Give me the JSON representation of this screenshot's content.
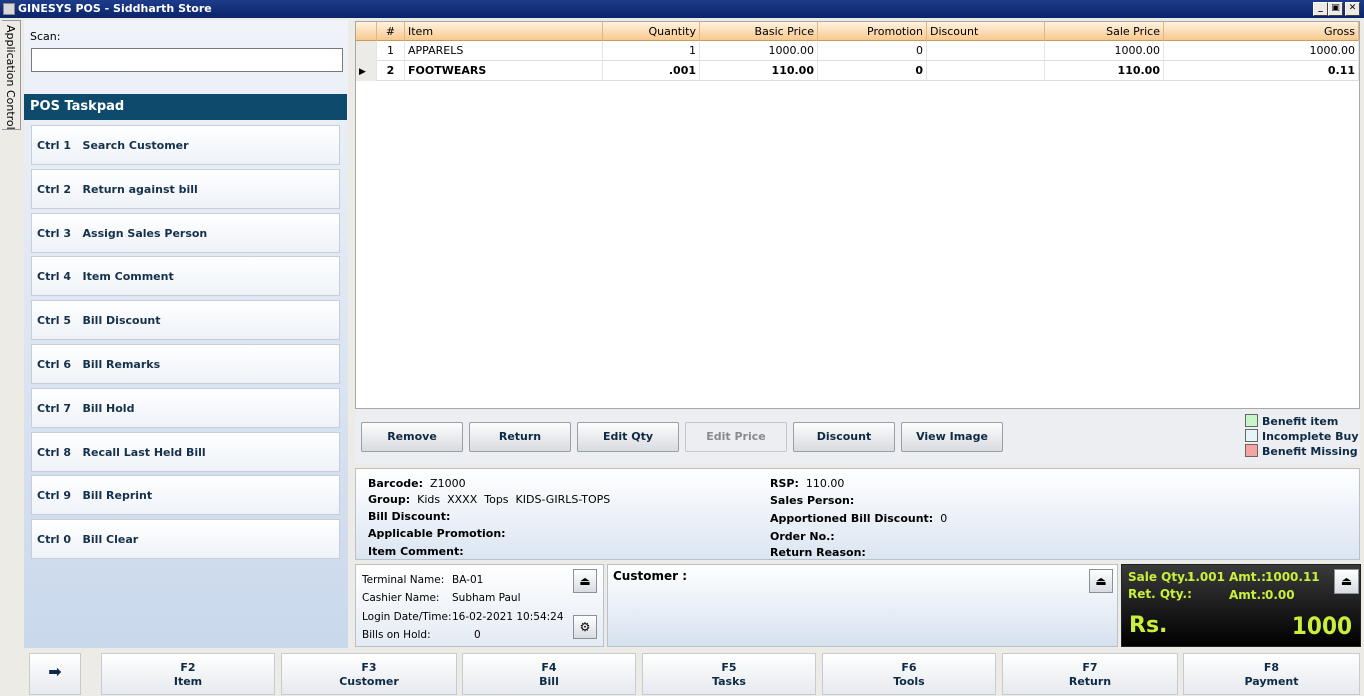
{
  "window": {
    "title": "GINESYS POS - Siddharth Store"
  },
  "app_control": {
    "label": "Application Control"
  },
  "scan": {
    "label": "Scan:",
    "value": ""
  },
  "taskpad": {
    "title": "POS Taskpad",
    "items": [
      {
        "key": "Ctrl 1",
        "label": "Search Customer"
      },
      {
        "key": "Ctrl 2",
        "label": "Return against bill"
      },
      {
        "key": "Ctrl 3",
        "label": "Assign Sales Person"
      },
      {
        "key": "Ctrl 4",
        "label": "Item Comment"
      },
      {
        "key": "Ctrl 5",
        "label": "Bill Discount"
      },
      {
        "key": "Ctrl 6",
        "label": "Bill Remarks"
      },
      {
        "key": "Ctrl 7",
        "label": "Bill Hold"
      },
      {
        "key": "Ctrl 8",
        "label": "Recall Last Held Bill"
      },
      {
        "key": "Ctrl 9",
        "label": "Bill Reprint"
      },
      {
        "key": "Ctrl 0",
        "label": "Bill Clear"
      }
    ]
  },
  "grid": {
    "columns": [
      "#",
      "Item",
      "Quantity",
      "Basic Price",
      "Promotion",
      "Discount",
      "Sale Price",
      "Gross"
    ],
    "rows": [
      {
        "no": "1",
        "item": "APPARELS",
        "qty": "1",
        "basic": "1000.00",
        "promo": "0",
        "disc": "",
        "sale": "1000.00",
        "gross": "1000.00"
      },
      {
        "no": "2",
        "item": "FOOTWEARS",
        "qty": ".001",
        "basic": "110.00",
        "promo": "0",
        "disc": "",
        "sale": "110.00",
        "gross": "0.11"
      }
    ],
    "selected_row": 2
  },
  "actions": {
    "remove": "Remove",
    "return": "Return",
    "edit_qty": "Edit Qty",
    "edit_price": "Edit Price",
    "discount": "Discount",
    "view_image": "View Image"
  },
  "legend": [
    {
      "label": "Benefit item",
      "color": "#c8f5c8"
    },
    {
      "label": "Incomplete Buy",
      "color": "#e6f4fa"
    },
    {
      "label": "Benefit Missing",
      "color": "#f5a3a3"
    }
  ],
  "details": {
    "barcode_label": "Barcode:",
    "barcode": "Z1000",
    "group_label": "Group:",
    "group": "Kids  XXXX  Tops  KIDS-GIRLS-TOPS",
    "bill_discount_label": "Bill Discount:",
    "applicable_promotion_label": "Applicable Promotion:",
    "item_comment_label": "Item Comment:",
    "rsp_label": "RSP:",
    "rsp": "110.00",
    "sales_person_label": "Sales Person:",
    "apportioned_label": "Apportioned Bill Discount:",
    "apportioned": "0",
    "order_no_label": "Order No.:",
    "return_reason_label": "Return Reason:"
  },
  "terminal": {
    "terminal_label": "Terminal Name:",
    "terminal": "BA-01",
    "cashier_label": "Cashier Name:",
    "cashier": "Subham Paul",
    "login_label": "Login Date/Time:",
    "login": "16-02-2021 10:54:24",
    "hold_label": "Bills on Hold:",
    "hold": "0"
  },
  "customer": {
    "label": "Customer :"
  },
  "totals": {
    "sale_qty_label": "Sale Qty.:",
    "sale_qty": "1.001",
    "amt_label": "Amt.:",
    "amt": "1000.11",
    "ret_qty_label": "Ret. Qty.:",
    "ret_amt_label": "Amt.:",
    "ret_amt": "0.00",
    "currency": "Rs.",
    "total": "1000"
  },
  "fkeys": [
    {
      "key": "F2",
      "label": "Item"
    },
    {
      "key": "F3",
      "label": "Customer"
    },
    {
      "key": "F4",
      "label": "Bill"
    },
    {
      "key": "F5",
      "label": "Tasks"
    },
    {
      "key": "F6",
      "label": "Tools"
    },
    {
      "key": "F7",
      "label": "Return"
    },
    {
      "key": "F8",
      "label": "Payment"
    }
  ]
}
